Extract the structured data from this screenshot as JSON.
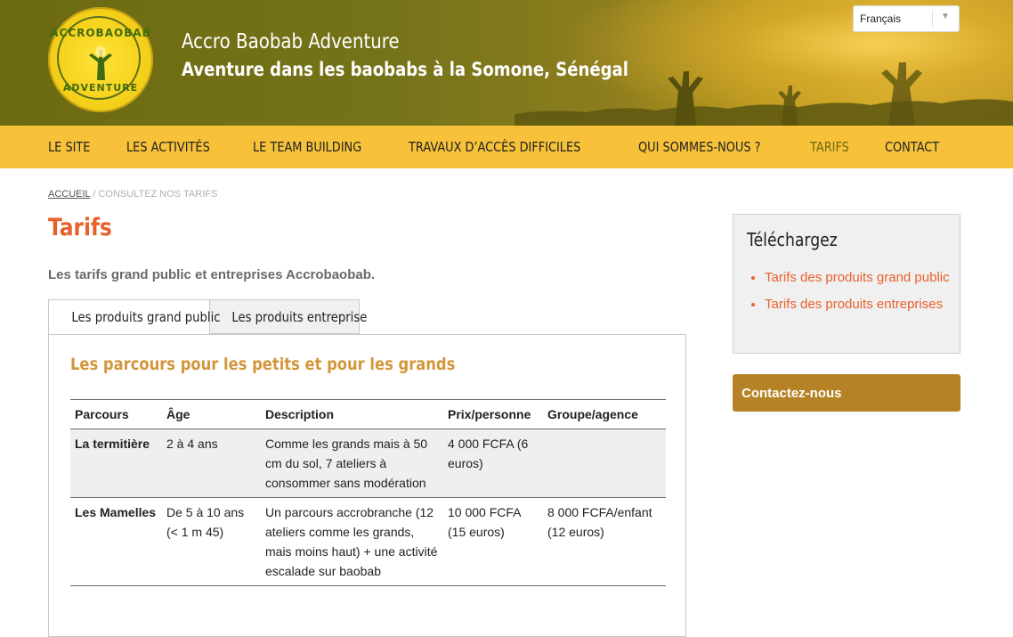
{
  "header": {
    "site_title": "Accro Baobab Adventure",
    "site_subtitle": "Aventure dans les baobabs à la Somone, Sénégal",
    "logo_text_top": "ACCROBAOBAB",
    "logo_text_bottom": "ADVENTURE",
    "language_selected": "Français"
  },
  "nav": {
    "items": [
      {
        "label": "LE SITE"
      },
      {
        "label": "LES ACTIVITÉS"
      },
      {
        "label": "LE TEAM BUILDING"
      },
      {
        "label": "TRAVAUX D’ACCÈS DIFFICILES"
      },
      {
        "label": "QUI SOMMES-NOUS ?"
      },
      {
        "label": "TARIFS",
        "active": true
      },
      {
        "label": "CONTACT"
      }
    ]
  },
  "breadcrumb": {
    "home": "ACCUEIL",
    "separator": " / ",
    "current": "CONSULTEZ NOS TARIFS"
  },
  "page": {
    "title": "Tarifs",
    "intro": "Les tarifs grand public et entreprises Accrobaobab."
  },
  "tabs": [
    {
      "label": "Les produits grand public",
      "active": true
    },
    {
      "label": "Les produits entreprise",
      "active": false
    }
  ],
  "section": {
    "title": "Les parcours pour les petits et pour les grands",
    "columns": [
      "Parcours",
      "Âge",
      "Description",
      "Prix/personne",
      "Groupe/agence"
    ],
    "rows": [
      {
        "parcours": "La termitière",
        "age": "2 à 4 ans",
        "description": "Comme les grands mais à 50 cm du sol, 7 ateliers à consommer sans modération",
        "prix": "4 000 FCFA (6 euros)",
        "groupe": ""
      },
      {
        "parcours": "Les Mamelles",
        "age": "De 5 à 10 ans (< 1 m 45)",
        "description": "Un parcours accrobranche (12 ateliers comme les grands, mais moins haut) + une activité escalade sur baobab",
        "prix": "10 000 FCFA (15 euros)",
        "groupe": "8 000 FCFA/enfant (12 euros)"
      }
    ]
  },
  "sidebar": {
    "download_title": "Téléchargez",
    "downloads": [
      {
        "label": "Tarifs des produits grand public"
      },
      {
        "label": "Tarifs des produits entreprises"
      }
    ],
    "contact_label": "Contactez-nous"
  },
  "colors": {
    "nav_bg": "#f7c23a",
    "accent_orange": "#e8612c",
    "section_gold": "#d3963a",
    "contact_bg": "#b58225",
    "header_olive": "#6b6a10"
  }
}
